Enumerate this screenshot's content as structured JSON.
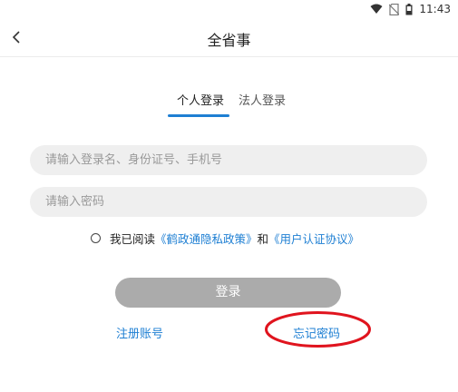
{
  "status_bar": {
    "time": "11:43",
    "icons": [
      "wifi-icon",
      "no-sim-icon",
      "battery-icon"
    ]
  },
  "app_bar": {
    "title": "全省事",
    "back_icon": "chevron-left-icon"
  },
  "tabs": [
    {
      "label": "个人登录",
      "active": true
    },
    {
      "label": "法人登录",
      "active": false
    }
  ],
  "form": {
    "account_placeholder": "请输入登录名、身份证号、手机号",
    "password_placeholder": "请输入密码",
    "agreement": {
      "prefix": "我已阅读",
      "privacy_link": "《鹤政通隐私政策》",
      "conjunction": "和",
      "user_agreement_link": "《用户认证协议》"
    },
    "login_label": "登录",
    "register_label": "注册账号",
    "forgot_label": "忘记密码"
  },
  "colors": {
    "accent": "#1e7fd3",
    "login_button_disabled": "#ababab",
    "annotation": "#e0141e"
  }
}
